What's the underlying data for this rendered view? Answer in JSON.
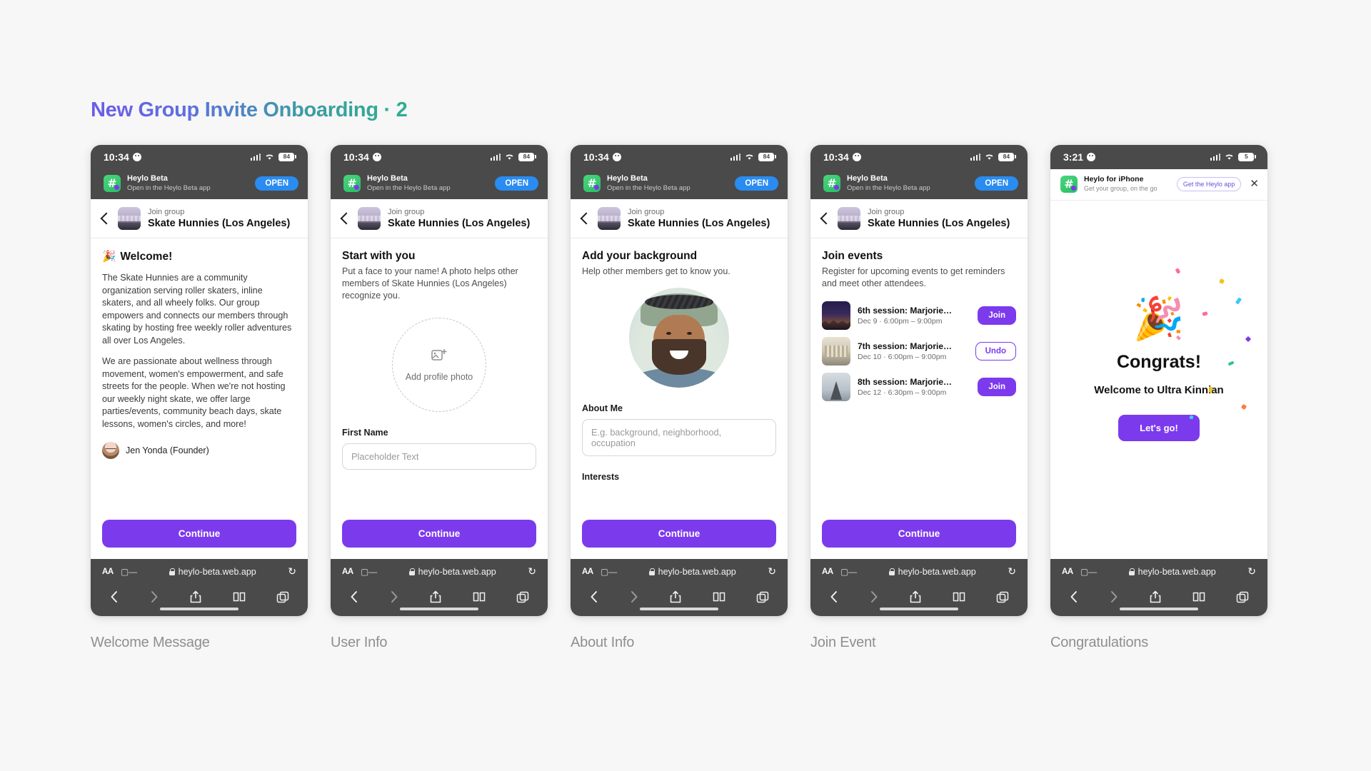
{
  "page": {
    "title": "New Group Invite Onboarding · 2",
    "title_gradient": [
      "#6c5ce7",
      "#2fae8e"
    ],
    "background": "#f7f7f7"
  },
  "common": {
    "status_bar": {
      "time": "10:34",
      "battery": "84",
      "icons": [
        "signal-icon",
        "wifi-icon",
        "battery-icon"
      ]
    },
    "app_banner": {
      "title": "Heylo Beta",
      "subtitle": "Open in the Heylo Beta app",
      "button": "OPEN",
      "accent": "#2a8cf0"
    },
    "header": {
      "kicker": "Join group",
      "group": "Skate Hunnies (Los Angeles)"
    },
    "cta": "Continue",
    "accent": "#7c3aed",
    "browser": {
      "aa": "AA",
      "url": "heylo-beta.web.app",
      "reload_icon": "reload-icon"
    }
  },
  "frames": [
    {
      "label": "Welcome Message",
      "screen": {
        "heading": "Welcome!",
        "heading_emoji": "🎉",
        "paragraphs": [
          "The Skate Hunnies are a community organization serving roller skaters, inline skaters, and all wheely folks. Our group empowers and connects our members through skating by hosting free weekly roller adventures all over Los Angeles.",
          "We are passionate about wellness through movement, women's empowerment, and safe streets for the people. When we're not hosting our weekly night skate, we offer large parties/events, community beach days, skate lessons, women's circles, and more!"
        ],
        "founder": "Jen Yonda (Founder)"
      }
    },
    {
      "label": "User Info",
      "screen": {
        "heading": "Start with you",
        "subheading": "Put a face to your name! A photo helps other members of Skate Hunnies (Los Angeles) recognize you.",
        "photo_placeholder": "Add profile photo",
        "field_label": "First Name",
        "field_placeholder": "Placeholder Text"
      }
    },
    {
      "label": "About Info",
      "screen": {
        "heading": "Add your background",
        "subheading": "Help other members get to know you.",
        "about_label": "About Me",
        "about_placeholder": "E.g. background, neighborhood, occupation",
        "interests_label": "Interests"
      }
    },
    {
      "label": "Join Event",
      "screen": {
        "heading": "Join events",
        "subheading": "Register for upcoming events to get reminders and meet other attendees.",
        "events": [
          {
            "title": "6th session: Marjorie…",
            "time": "Dec 9 · 6:00pm – 9:00pm",
            "action": "Join",
            "state": "default"
          },
          {
            "title": "7th session: Marjorie…",
            "time": "Dec 10 · 6:00pm – 9:00pm",
            "action": "Undo",
            "state": "joined"
          },
          {
            "title": "8th session: Marjorie…",
            "time": "Dec 12 · 6:30pm – 9:00pm",
            "action": "Join",
            "state": "default"
          }
        ]
      }
    },
    {
      "label": "Congratulations",
      "status_bar": {
        "time": "3:21",
        "battery": "5"
      },
      "banner": {
        "title": "Heylo for iPhone",
        "subtitle": "Get your group, on the go",
        "button": "Get the Heylo app",
        "close_icon": "close-icon"
      },
      "screen": {
        "emoji": "🎉",
        "heading": "Congrats!",
        "subheading": "Welcome to Ultra Kinnian",
        "button": "Let's go!"
      }
    }
  ]
}
